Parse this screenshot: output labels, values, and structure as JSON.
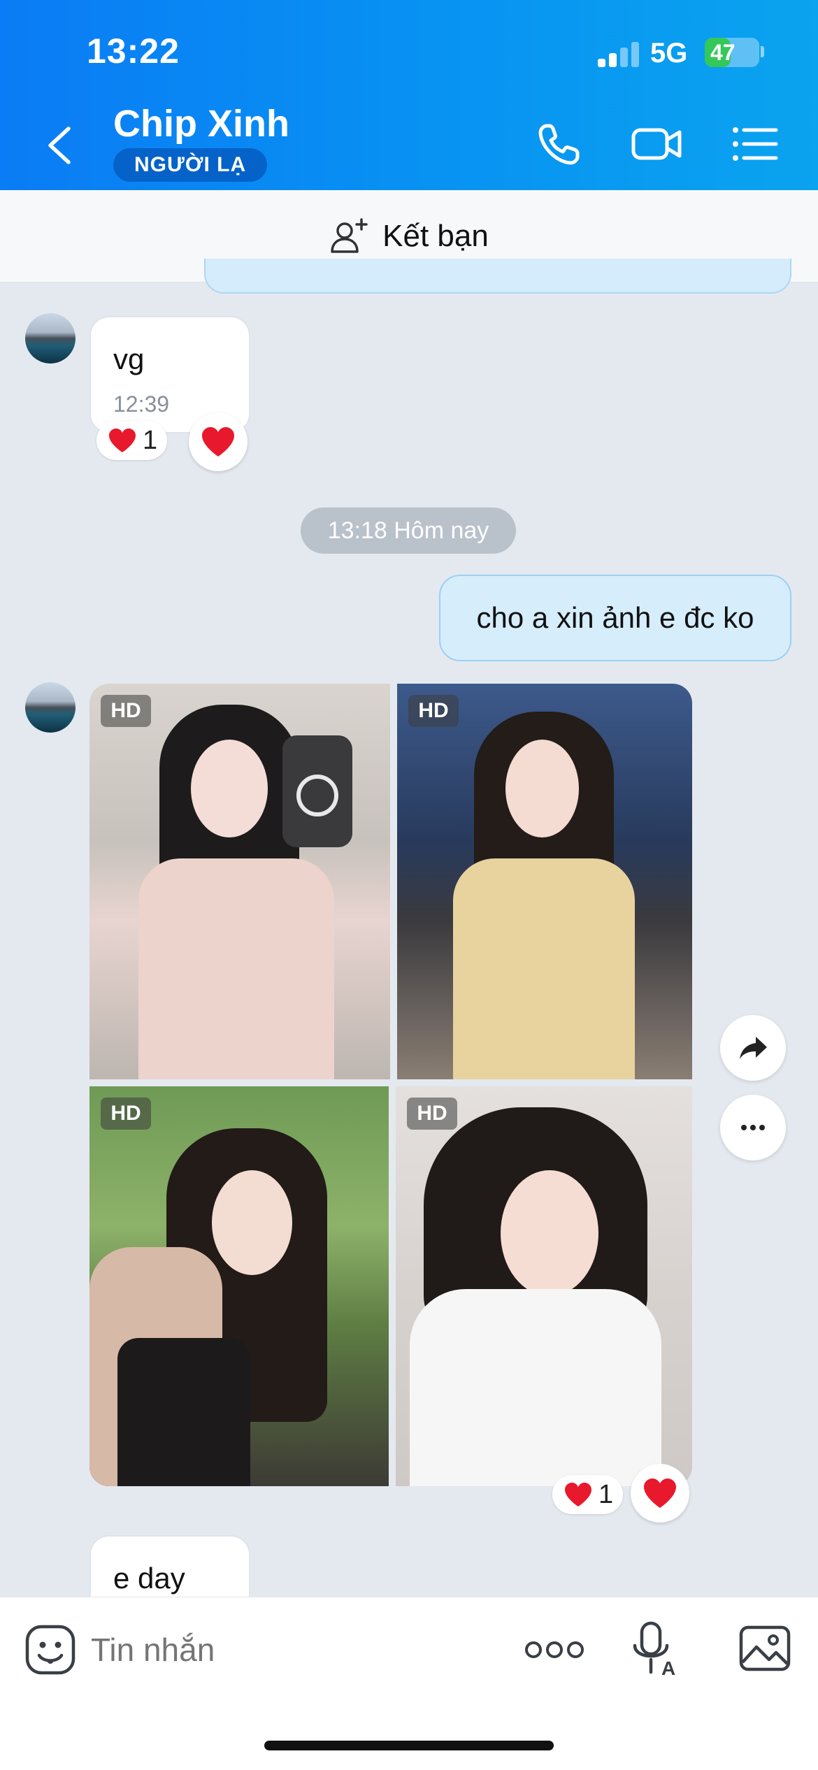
{
  "status_bar": {
    "time": "13:22",
    "network": "5G",
    "battery_level": "47",
    "battery_fraction": 0.47
  },
  "header": {
    "contact_name": "Chip Xinh",
    "badge": "NGƯỜI LẠ",
    "icons": [
      "back-icon",
      "phone-icon",
      "video-call-icon",
      "menu-list-icon"
    ]
  },
  "add_friend_bar": {
    "label": "Kết bạn",
    "icon": "add-user-icon"
  },
  "messages": [
    {
      "direction": "incoming",
      "text": "vg",
      "time": "12:39",
      "reaction_count": "1"
    },
    {
      "type": "date_separator",
      "text": "13:18 Hôm nay"
    },
    {
      "direction": "outgoing",
      "text": "cho a xin ảnh e đc ko"
    },
    {
      "direction": "incoming",
      "type": "photo_grid",
      "photos": [
        {
          "badge": "HD"
        },
        {
          "badge": "HD"
        },
        {
          "badge": "HD"
        },
        {
          "badge": "HD"
        }
      ],
      "reaction_count": "1"
    },
    {
      "direction": "incoming",
      "text": "e day"
    }
  ],
  "side_actions": [
    "share-forward-icon",
    "more-dots-icon"
  ],
  "composer": {
    "placeholder": "Tin nhắn",
    "icons": [
      "emoji-sticker-icon",
      "more-options-icon",
      "voice-to-text-icon",
      "image-gallery-icon"
    ]
  },
  "colors": {
    "header_gradient_start": "#0a7cf5",
    "header_gradient_end": "#0aa3ef",
    "badge_bg": "#0562c9",
    "chat_bg": "#e4e9f0",
    "outgoing_bubble": "#d6edfc",
    "reaction_heart": "#e8192c"
  }
}
